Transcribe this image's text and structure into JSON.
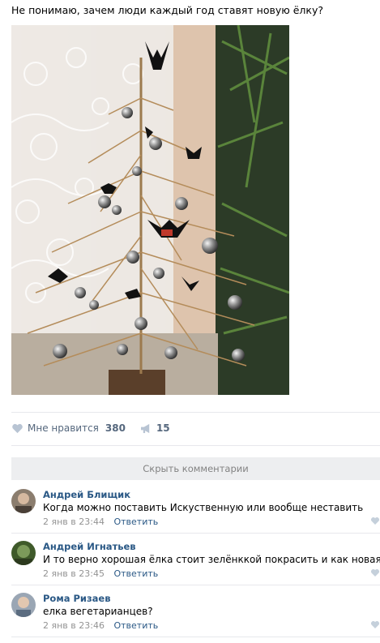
{
  "post": {
    "text": "Не понимаю, зачем люди каждый год ставят новую ёлку?"
  },
  "actions": {
    "like_label": "Мне нравится",
    "like_count": "380",
    "share_count": "15"
  },
  "comments_toggle": "Скрыть комментарии",
  "comments": [
    {
      "author": "Андрей Блищик",
      "text": "Когда можно поставить Искуственную или вообще неставить",
      "date": "2 янв в 23:44",
      "reply": "Ответить"
    },
    {
      "author": "Андрей Игнатьев",
      "text": "И то верно хорошая ёлка стоит зелёнккой покрасить и как новая",
      "date": "2 янв в 23:45",
      "reply": "Ответить"
    },
    {
      "author": "Рома Ризаев",
      "text": "елка вегетарианцев?",
      "date": "2 янв в 23:46",
      "reply": "Ответить"
    }
  ],
  "colors": {
    "link": "#2a5885",
    "muted": "#828282",
    "action": "#55677d"
  }
}
